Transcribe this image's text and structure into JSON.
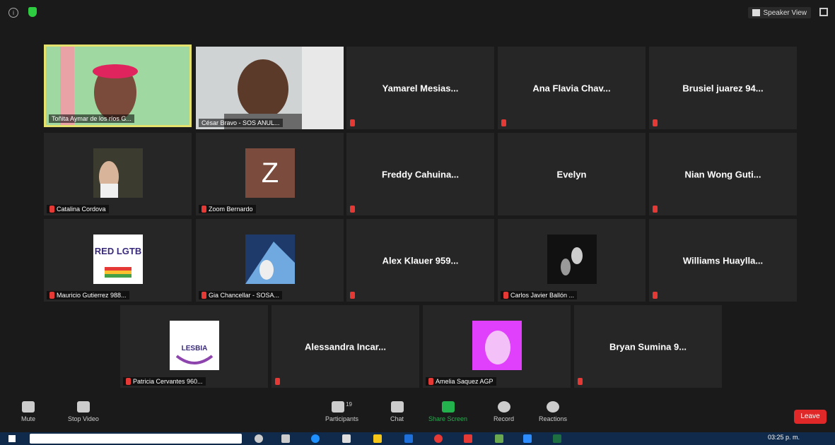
{
  "topbar": {
    "speaker_view": "Speaker View"
  },
  "tiles": [
    {
      "name": "Toñita Aymar de los ríos G...",
      "type": "photo"
    },
    {
      "name": "César Bravo - SOS ANUL...",
      "type": "photo"
    },
    {
      "name": "Yamarel Mesias...",
      "type": "name"
    },
    {
      "name": "Ana Flavia Chav...",
      "type": "name"
    },
    {
      "name": "Brusiel juarez 94...",
      "type": "name"
    },
    {
      "name": "Catalina Cordova",
      "type": "photo"
    },
    {
      "name": "Zoom Bernardo",
      "type": "avatar",
      "initial": "Z"
    },
    {
      "name": "Freddy Cahuina...",
      "type": "name"
    },
    {
      "name": "Evelyn",
      "type": "name"
    },
    {
      "name": "Nian Wong Guti...",
      "type": "name"
    },
    {
      "name": "Mauricio Gutierrez 988...",
      "type": "logo"
    },
    {
      "name": "Gia Chancellar - SOSA...",
      "type": "photo"
    },
    {
      "name": "Alex Klauer 959...",
      "type": "name"
    },
    {
      "name": "Carlos Javier Ballón ...",
      "type": "photo"
    },
    {
      "name": "Williams Huaylla...",
      "type": "name"
    },
    {
      "name": "Patricia Cervantes 960...",
      "type": "logo"
    },
    {
      "name": "Alessandra Incar...",
      "type": "name"
    },
    {
      "name": "Amelia Saquez AGP",
      "type": "photo"
    },
    {
      "name": "Bryan Sumina 9...",
      "type": "name"
    }
  ],
  "logos": {
    "red_lgtb": "RED LGTB",
    "lesbia": "LESBIA"
  },
  "controls": {
    "mute": "Mute",
    "stop_video": "Stop Video",
    "participants": "Participants",
    "participants_count": "19",
    "chat": "Chat",
    "share_screen": "Share Screen",
    "record": "Record",
    "reactions": "Reactions",
    "leave": "Leave"
  },
  "taskbar": {
    "time": "03:25 p. m."
  }
}
